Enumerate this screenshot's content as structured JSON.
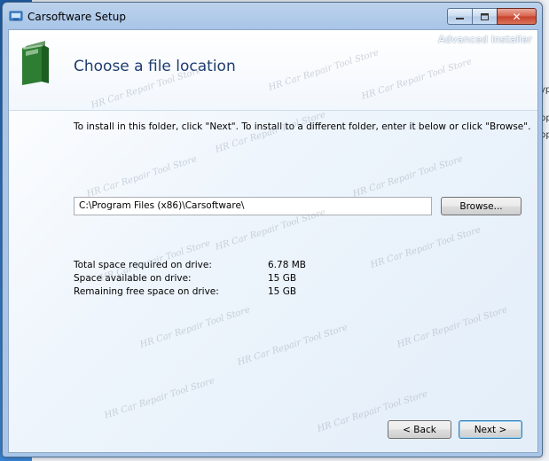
{
  "window": {
    "title": "Carsoftware Setup",
    "branding": "Advanced Installer",
    "controls": {
      "minimize": "−",
      "maximize": "□",
      "close": "✕"
    }
  },
  "page": {
    "title": "Choose a file location",
    "instructions": "To install in this folder, click \"Next\". To install to a different folder, enter it below or click \"Browse\"."
  },
  "install": {
    "path": "C:\\Program Files (x86)\\Carsoftware\\",
    "browse_label": "Browse..."
  },
  "space": [
    {
      "label": "Total space required on drive:",
      "value": "6.78 MB"
    },
    {
      "label": "Space available on drive:",
      "value": "15 GB"
    },
    {
      "label": "Remaining free space on drive:",
      "value": "15 GB"
    }
  ],
  "buttons": {
    "back": "< Back",
    "next": "Next >"
  },
  "watermark_text": "HR Car Repair Tool Store",
  "colors": {
    "title_text": "#1f3c6e",
    "folder_green": "#2e7d32",
    "default_button_border": "#3c7fb1"
  }
}
